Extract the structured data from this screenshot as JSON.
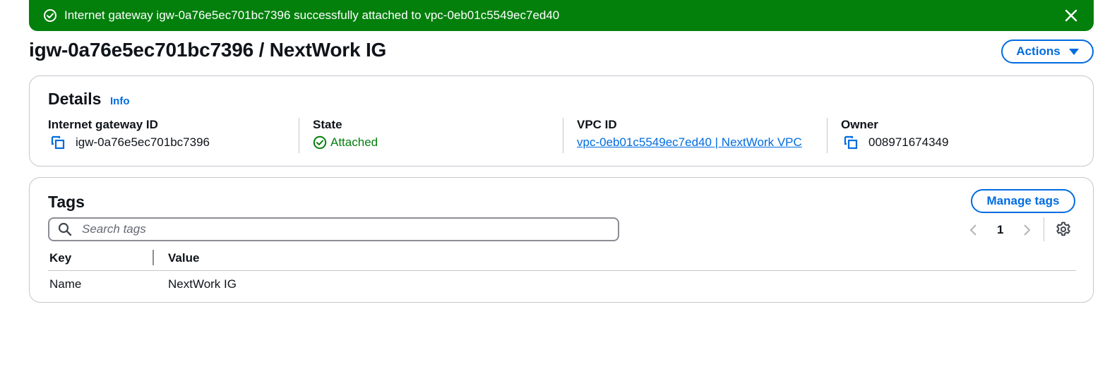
{
  "flash": {
    "message": "Internet gateway igw-0a76e5ec701bc7396 successfully attached to vpc-0eb01c5549ec7ed40",
    "type": "success",
    "color": "#037f0c"
  },
  "header": {
    "title": "igw-0a76e5ec701bc7396 / NextWork IG",
    "actions_label": "Actions"
  },
  "details": {
    "heading": "Details",
    "info_label": "Info",
    "fields": [
      {
        "label": "Internet gateway ID",
        "value": "igw-0a76e5ec701bc7396"
      },
      {
        "label": "State",
        "value": "Attached"
      },
      {
        "label": "VPC ID",
        "value": "vpc-0eb01c5549ec7ed40 | NextWork VPC"
      },
      {
        "label": "Owner",
        "value": "008971674349"
      }
    ]
  },
  "tags": {
    "heading": "Tags",
    "manage_label": "Manage tags",
    "search_placeholder": "Search tags",
    "page": "1",
    "columns": [
      "Key",
      "Value"
    ],
    "rows": [
      {
        "key": "Name",
        "value": "NextWork IG"
      }
    ]
  },
  "colors": {
    "accent": "#006ce0",
    "success": "#037f0c",
    "border": "#c6c6cd"
  },
  "icons": {
    "flash": "check-circle-icon",
    "close": "close-icon",
    "copy": "copy-icon",
    "state": "check-circle-icon",
    "search": "search-icon",
    "prev": "chevron-left-icon",
    "next": "chevron-right-icon",
    "settings": "gear-icon",
    "dropdown": "caret-down-icon"
  }
}
